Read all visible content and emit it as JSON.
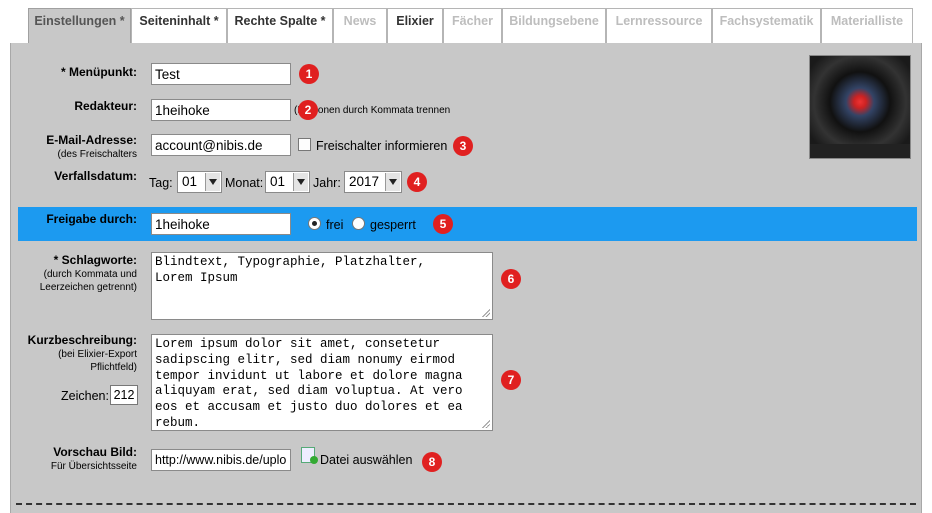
{
  "tabs": [
    {
      "label": "Einstellungen *",
      "state": "active"
    },
    {
      "label": "Seiteninhalt *",
      "state": "enabled"
    },
    {
      "label": "Rechte Spalte *",
      "state": "enabled"
    },
    {
      "label": "News",
      "state": "disabled"
    },
    {
      "label": "Elixier",
      "state": "enabled"
    },
    {
      "label": "Fächer",
      "state": "disabled"
    },
    {
      "label": "Bildungsebene",
      "state": "disabled"
    },
    {
      "label": "Lernressource",
      "state": "disabled"
    },
    {
      "label": "Fachsystematik",
      "state": "disabled"
    },
    {
      "label": "Materialliste",
      "state": "disabled"
    }
  ],
  "form": {
    "menupunkt": {
      "label": "* Menüpunkt:",
      "value": "Test",
      "badge": "1"
    },
    "redakteur": {
      "label": "Redakteur:",
      "value": "1heihoke",
      "hint": "(Personen durch Kommata trennen",
      "badge": "2"
    },
    "email": {
      "label": "E-Mail-Adresse:",
      "sub": "(des Freischalters",
      "value": "account@nibis.de",
      "checkbox_label": "Freischalter informieren",
      "checked": false,
      "badge": "3"
    },
    "verfall": {
      "label": "Verfallsdatum:",
      "tag_label": "Tag:",
      "tag": "01",
      "monat_label": "Monat:",
      "monat": "01",
      "jahr_label": "Jahr:",
      "jahr": "2017",
      "badge": "4"
    },
    "freigabe": {
      "label": "Freigabe durch:",
      "value": "1heihoke",
      "option_frei": "frei",
      "option_gesperrt": "gesperrt",
      "selected": "frei",
      "badge": "5"
    },
    "schlagworte": {
      "label": "* Schlagworte:",
      "sub1": "(durch Kommata und",
      "sub2": "Leerzeichen getrennt)",
      "value": "Blindtext, Typographie, Platzhalter,\nLorem Ipsum",
      "badge": "6"
    },
    "kurz": {
      "label": "Kurzbeschreibung:",
      "sub1": "(bei Elixier-Export",
      "sub2": "Pflichtfeld)",
      "zeichen_label": "Zeichen:",
      "zeichen": "212",
      "value": "Lorem ipsum dolor sit amet, consetetur\nsadipscing elitr, sed diam nonumy eirmod\ntempor invidunt ut labore et dolore magna\naliquyam erat, sed diam voluptua. At vero\neos et accusam et justo duo dolores et ea\nrebum.",
      "badge": "7"
    },
    "vorschau": {
      "label": "Vorschau Bild:",
      "sub": "Für Übersichtsseite",
      "value": "http://www.nibis.de/uplo",
      "file_label": "Datei auswählen",
      "badge": "8"
    }
  },
  "preview_image": {
    "icon": "camera-lens-photo"
  },
  "colors": {
    "panel": "#c8c8c8",
    "highlight": "#1c9af0",
    "badge": "#e02020"
  }
}
